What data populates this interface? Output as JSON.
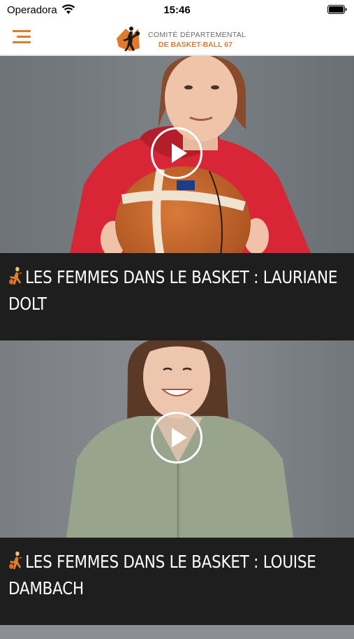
{
  "status_bar": {
    "carrier": "Operadora",
    "time": "15:46"
  },
  "header": {
    "menu_icon": "hamburger-menu-icon",
    "brand_line1": "COMITÉ DÉPARTEMENTAL",
    "brand_line2": "DE BASKET-BALL 67",
    "colors": {
      "accent": "#e07b2e",
      "caption_bg": "#1e1e1e"
    }
  },
  "articles": [
    {
      "title": "LES FEMMES DANS LE BASKET : LAURIANE DOLT",
      "icon": "basketball-player-icon",
      "media": "video"
    },
    {
      "title": "LES FEMMES DANS LE BASKET : LOUISE DAMBACH",
      "icon": "basketball-player-icon",
      "media": "video"
    }
  ]
}
